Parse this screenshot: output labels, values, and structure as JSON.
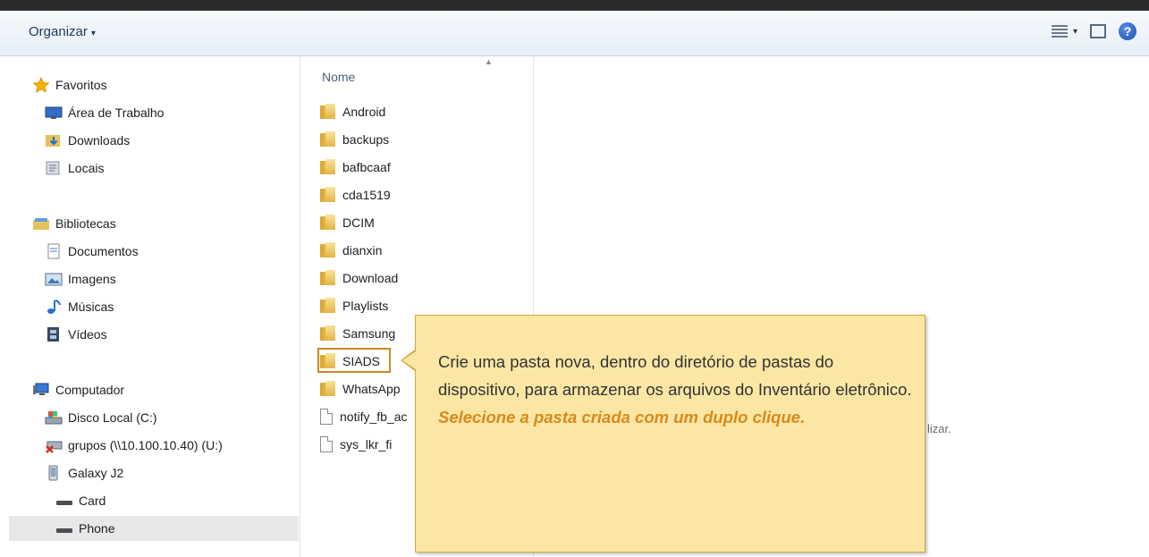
{
  "toolbar": {
    "organize_label": "Organizar",
    "organize_caret": "▾",
    "views_caret": "▾",
    "help_glyph": "?"
  },
  "nav": {
    "favorites": {
      "label": "Favoritos",
      "items": [
        "Área de Trabalho",
        "Downloads",
        "Locais"
      ]
    },
    "libraries": {
      "label": "Bibliotecas",
      "items": [
        "Documentos",
        "Imagens",
        "Músicas",
        "Vídeos"
      ]
    },
    "computer": {
      "label": "Computador",
      "items": [
        "Disco Local (C:)",
        "grupos (\\\\10.100.10.40) (U:)",
        "Galaxy J2",
        "Card",
        "Phone"
      ]
    }
  },
  "file_list": {
    "column_header": "Nome",
    "sort_arrow": "▲",
    "items": [
      "Android",
      "backups",
      "bafbcaaf",
      "cda1519",
      "DCIM",
      "dianxin",
      "Download",
      "Playlists",
      "Samsung",
      "SIADS",
      "WhatsApp",
      "notify_fb_ac",
      "sys_lkr_fi"
    ]
  },
  "callout": {
    "text_plain": "Crie uma pasta nova, dentro do diretório de pastas do dispositivo, para armazenar os arquivos do Inventário eletrônico. ",
    "text_emphasis": "Selecione a pasta criada com um duplo clique."
  },
  "partial_text": "lizar.",
  "colors": {
    "callout_bg": "#fbe6a4",
    "callout_border": "#d7a640",
    "emphasis": "#d98a1c",
    "highlight_border": "#cc8a1e",
    "selected_row": "#e8e8e8"
  }
}
